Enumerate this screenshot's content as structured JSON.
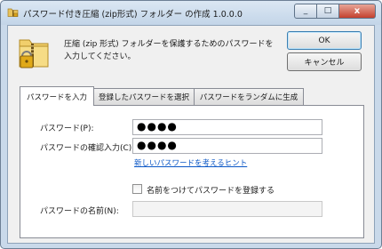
{
  "window": {
    "title": "パスワード付き圧縮 (zip形式) フォルダー の作成 1.0.0.0",
    "minimize_glyph": "_",
    "maximize_glyph": "□",
    "close_glyph": "x"
  },
  "header": {
    "description": "圧縮 (zip 形式) フォルダーを保護するためのパスワードを入力してください。"
  },
  "buttons": {
    "ok_label": "OK",
    "cancel_label": "キャンセル"
  },
  "tabs": [
    {
      "label": "パスワードを入力",
      "active": true
    },
    {
      "label": "登録したパスワードを選択",
      "active": false
    },
    {
      "label": "パスワードをランダムに生成",
      "active": false
    }
  ],
  "form": {
    "password_label": "パスワード(P):",
    "password_value": "●●●●",
    "confirm_label": "パスワードの確認入力(C):",
    "confirm_value": "●●●●",
    "hint_link": "新しいパスワードを考えるヒント",
    "register_checkbox_label": "名前をつけてパスワードを登録する",
    "register_checked": false,
    "name_label": "パスワードの名前(N):",
    "name_value": ""
  },
  "colors": {
    "accent": "#3c7fb1",
    "link": "#0b57c6",
    "close_button": "#c4412e"
  },
  "icons": {
    "title": "zip-folder-lock-icon",
    "header": "zip-folder-lock-icon"
  }
}
